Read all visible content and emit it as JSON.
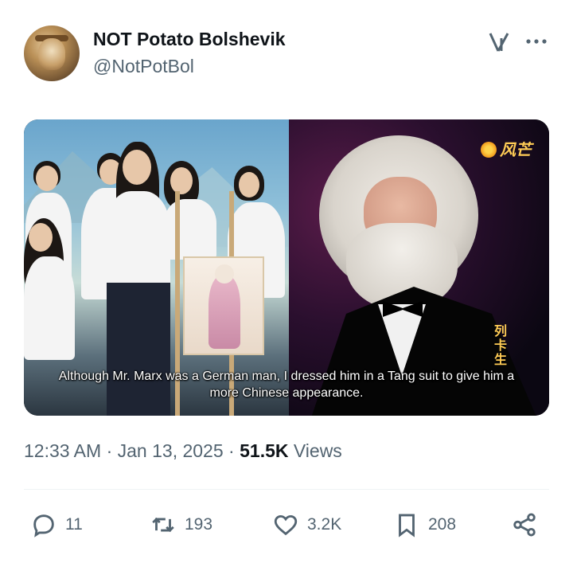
{
  "tweet": {
    "author_name": "NOT Potato Bolshevik",
    "author_handle": "@NotPotBol",
    "time": "12:33 AM",
    "date": "Jan 13, 2025",
    "views_count": "51.5K",
    "views_label": "Views",
    "separator": "·"
  },
  "media": {
    "caption_line1": "Although Mr. Marx was a German man, I dressed him in a Tang suit to give him a",
    "caption_line2": "more Chinese appearance.",
    "channel_logo": "风芒",
    "side_text": "列卡生"
  },
  "actions": {
    "replies": "11",
    "reposts": "193",
    "likes": "3.2K",
    "bookmarks": "208"
  },
  "icons": {
    "grok": "grok-icon",
    "more": "more-icon",
    "reply": "reply-icon",
    "repost": "repost-icon",
    "like": "heart-icon",
    "bookmark": "bookmark-icon",
    "share": "share-icon"
  },
  "colors": {
    "text_primary": "#0f1419",
    "text_secondary": "#536471",
    "logo_accent": "#ffcc55"
  }
}
